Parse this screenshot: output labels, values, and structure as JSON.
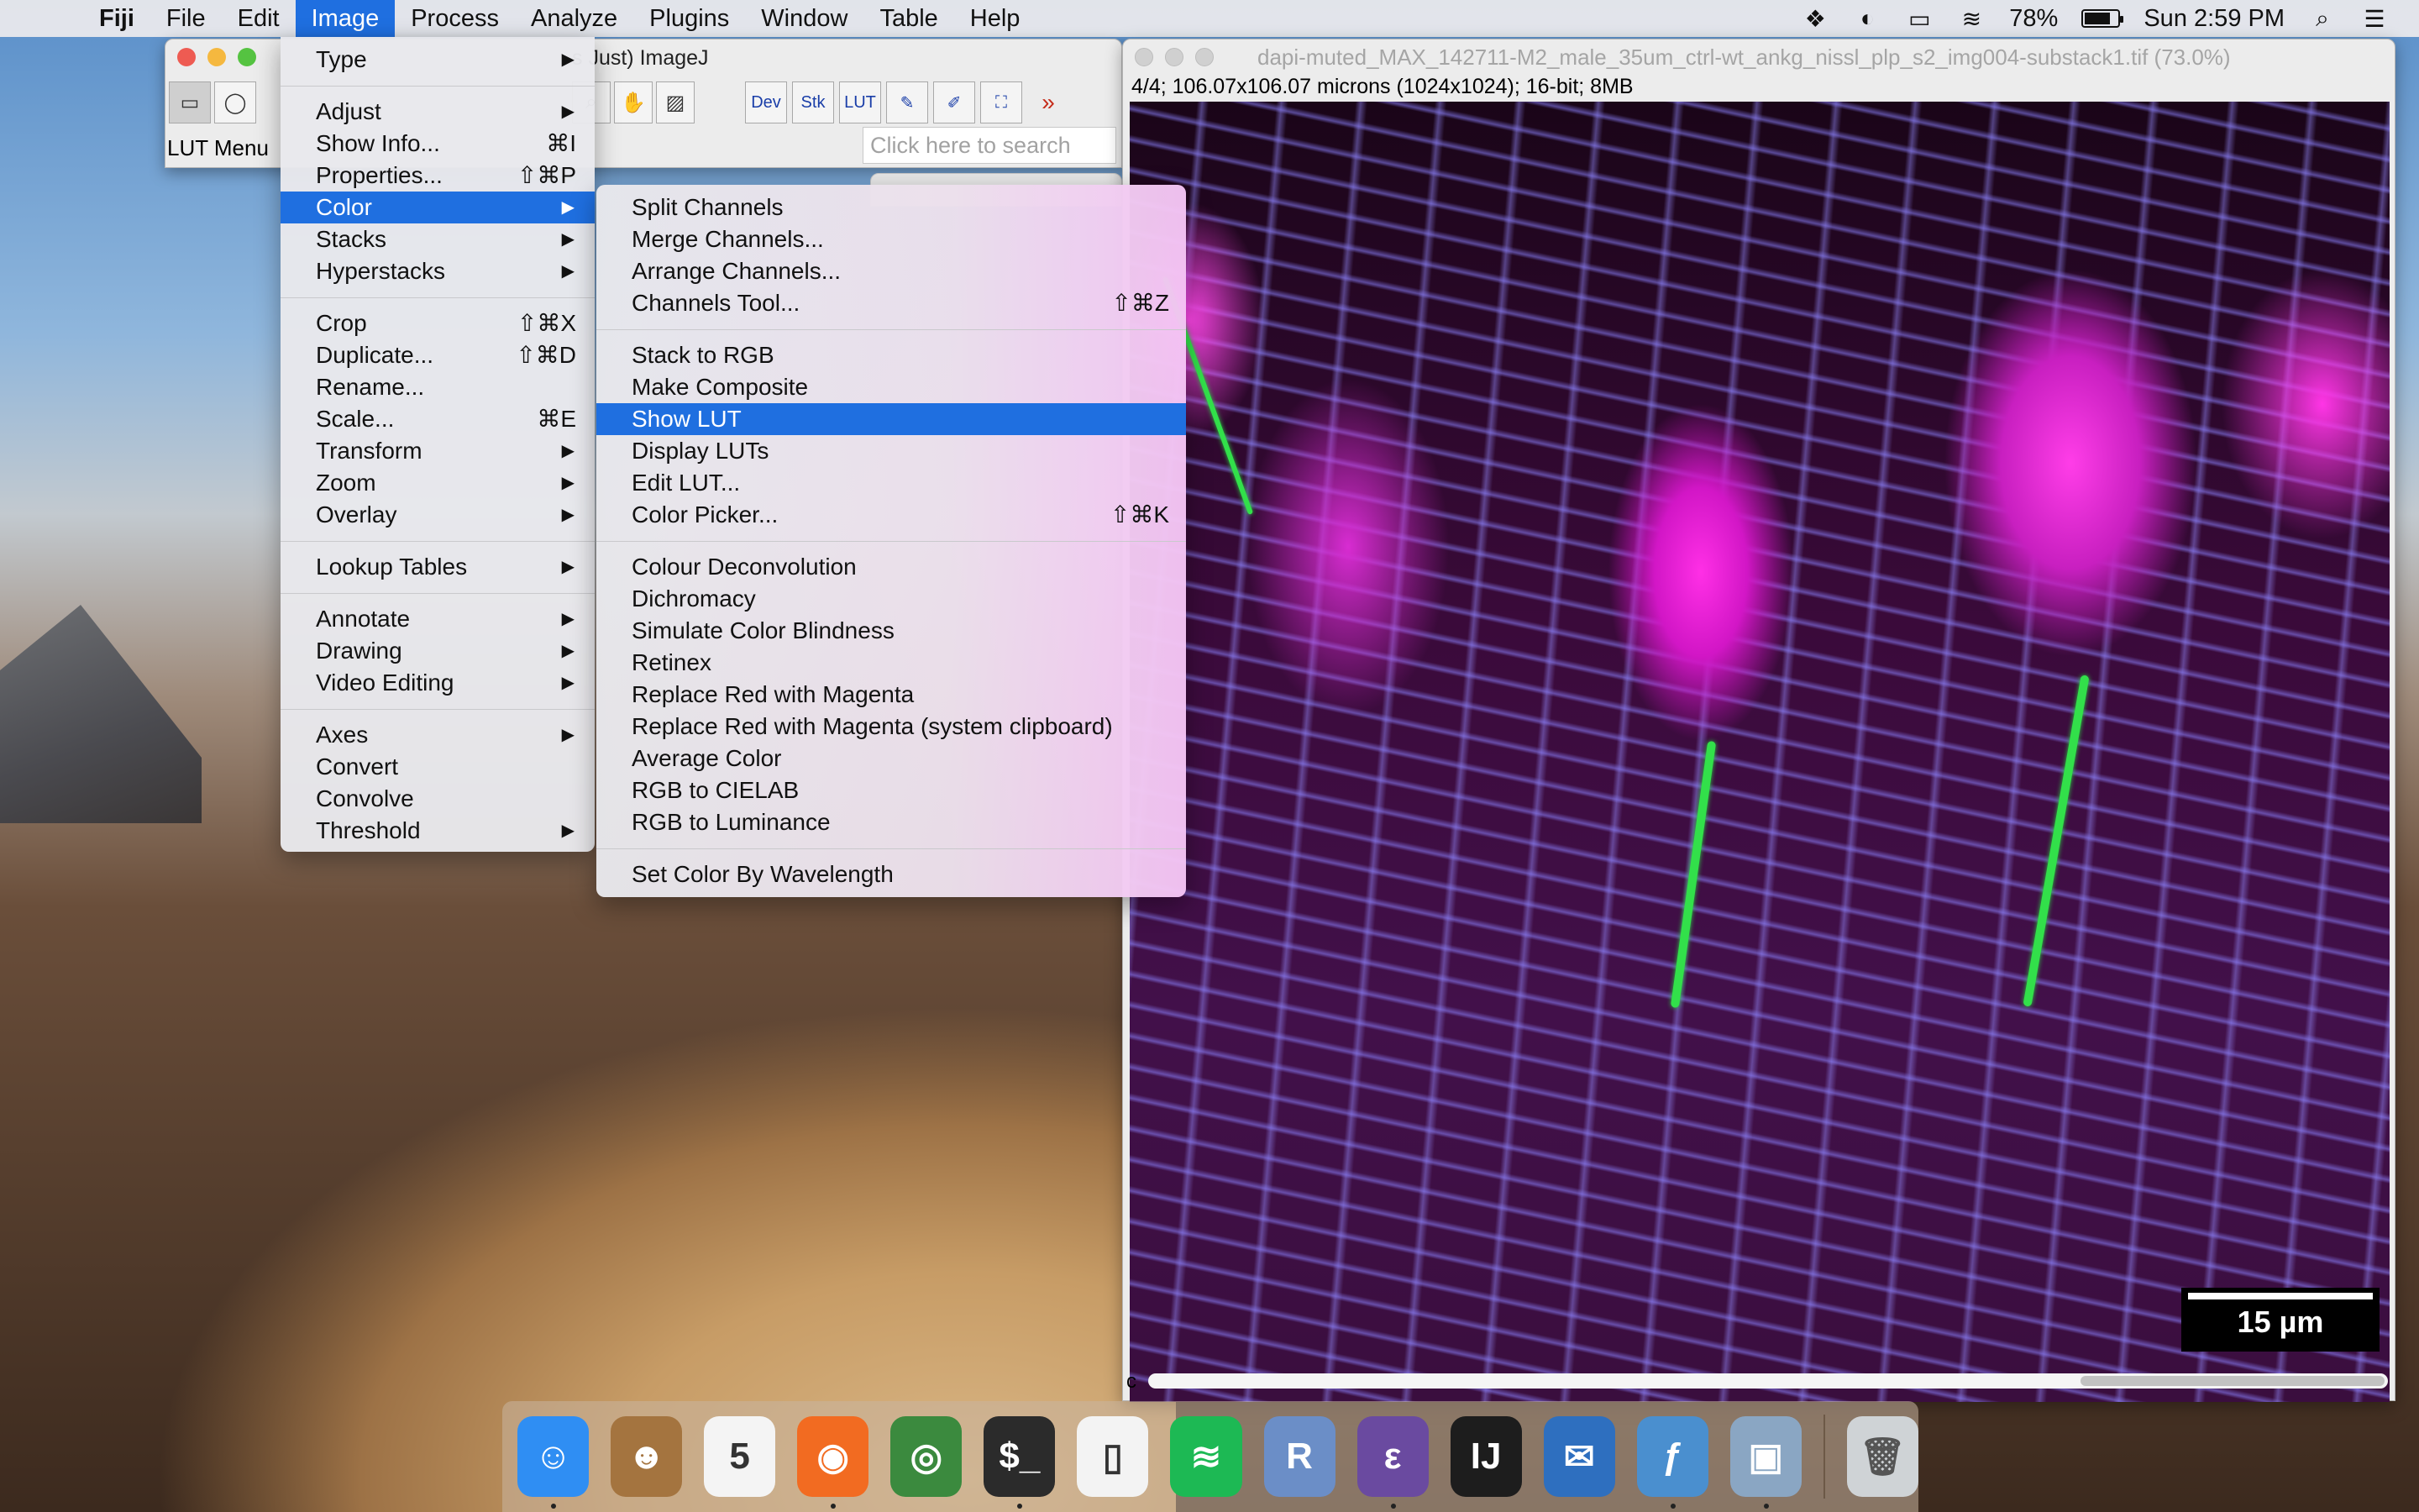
{
  "menubar": {
    "app": "Fiji",
    "items": [
      "File",
      "Edit",
      "Image",
      "Process",
      "Analyze",
      "Plugins",
      "Window",
      "Table",
      "Help"
    ],
    "active": "Image",
    "battery": "78%",
    "clock": "Sun 2:59 PM"
  },
  "fiji": {
    "title": "s Just) ImageJ",
    "status": "LUT Menu",
    "search_placeholder": "Click here to search",
    "tools_right": [
      "Dev",
      "Stk",
      "LUT",
      "✎",
      "✐",
      "⛶",
      "»"
    ]
  },
  "image_window": {
    "title": "dapi-muted_MAX_142711-M2_male_35um_ctrl-wt_ankg_nissl_plp_s2_img004-substack1.tif (73.0%)",
    "info": "4/4; 106.07x106.07 microns (1024x1024); 16-bit; 8MB",
    "scalebar": "15 µm",
    "channel_label": "c"
  },
  "image_menu": {
    "groups": [
      [
        {
          "label": "Type",
          "sub": true
        }
      ],
      [
        {
          "label": "Adjust",
          "sub": true
        },
        {
          "label": "Show Info...",
          "shortcut": "⌘I"
        },
        {
          "label": "Properties...",
          "shortcut": "⇧⌘P"
        },
        {
          "label": "Color",
          "sub": true,
          "highlight": true
        },
        {
          "label": "Stacks",
          "sub": true
        },
        {
          "label": "Hyperstacks",
          "sub": true
        }
      ],
      [
        {
          "label": "Crop",
          "shortcut": "⇧⌘X"
        },
        {
          "label": "Duplicate...",
          "shortcut": "⇧⌘D"
        },
        {
          "label": "Rename..."
        },
        {
          "label": "Scale...",
          "shortcut": "⌘E"
        },
        {
          "label": "Transform",
          "sub": true
        },
        {
          "label": "Zoom",
          "sub": true
        },
        {
          "label": "Overlay",
          "sub": true
        }
      ],
      [
        {
          "label": "Lookup Tables",
          "sub": true
        }
      ],
      [
        {
          "label": "Annotate",
          "sub": true
        },
        {
          "label": "Drawing",
          "sub": true
        },
        {
          "label": "Video Editing",
          "sub": true
        }
      ],
      [
        {
          "label": "Axes",
          "sub": true
        },
        {
          "label": "Convert"
        },
        {
          "label": "Convolve"
        },
        {
          "label": "Threshold",
          "sub": true
        }
      ]
    ]
  },
  "color_menu": {
    "groups": [
      [
        {
          "label": "Split Channels"
        },
        {
          "label": "Merge Channels..."
        },
        {
          "label": "Arrange Channels..."
        },
        {
          "label": "Channels Tool...",
          "shortcut": "⇧⌘Z"
        }
      ],
      [
        {
          "label": "Stack to RGB"
        },
        {
          "label": "Make Composite"
        },
        {
          "label": "Show LUT",
          "highlight": true
        },
        {
          "label": "Display LUTs"
        },
        {
          "label": "Edit LUT..."
        },
        {
          "label": "Color Picker...",
          "shortcut": "⇧⌘K"
        }
      ],
      [
        {
          "label": "Colour Deconvolution"
        },
        {
          "label": "Dichromacy"
        },
        {
          "label": "Simulate Color Blindness"
        },
        {
          "label": "Retinex"
        },
        {
          "label": "Replace Red with Magenta"
        },
        {
          "label": "Replace Red with Magenta (system clipboard)"
        },
        {
          "label": "Average Color"
        },
        {
          "label": "RGB to CIELAB"
        },
        {
          "label": "RGB to Luminance"
        }
      ],
      [
        {
          "label": "Set Color By Wavelength"
        }
      ]
    ]
  },
  "dock": {
    "apps": [
      {
        "name": "finder-icon",
        "glyph": "☺",
        "color": "#2f8ef3",
        "running": true
      },
      {
        "name": "contacts-icon",
        "glyph": "☻",
        "color": "#a4743f",
        "running": false
      },
      {
        "name": "calendar-icon",
        "glyph": "5",
        "color": "#f4f4f4",
        "running": false
      },
      {
        "name": "firefox-icon",
        "glyph": "◉",
        "color": "#f26b21",
        "running": true
      },
      {
        "name": "chrome-icon",
        "glyph": "◎",
        "color": "#3b8a3e",
        "running": false
      },
      {
        "name": "terminal-icon",
        "glyph": "$_",
        "color": "#2b2b2b",
        "running": true
      },
      {
        "name": "file-icon",
        "glyph": "▯",
        "color": "#f3f3f3",
        "running": false
      },
      {
        "name": "spotify-icon",
        "glyph": "≋",
        "color": "#1db954",
        "running": false
      },
      {
        "name": "r-icon",
        "glyph": "R",
        "color": "#6b8ec7",
        "running": false
      },
      {
        "name": "emacs-icon",
        "glyph": "ε",
        "color": "#6a4aa0",
        "running": true
      },
      {
        "name": "intellij-icon",
        "glyph": "IJ",
        "color": "#1d1d1d",
        "running": false
      },
      {
        "name": "thunderbird-icon",
        "glyph": "✉",
        "color": "#2e6fbf",
        "running": false
      },
      {
        "name": "fiji-icon",
        "glyph": "ƒ",
        "color": "#4a8fcf",
        "running": true
      },
      {
        "name": "preview-icon",
        "glyph": "▣",
        "color": "#8aa6c3",
        "running": true
      }
    ],
    "trash": {
      "name": "trash-icon",
      "glyph": "🗑",
      "color": "#cfd3d6"
    }
  }
}
